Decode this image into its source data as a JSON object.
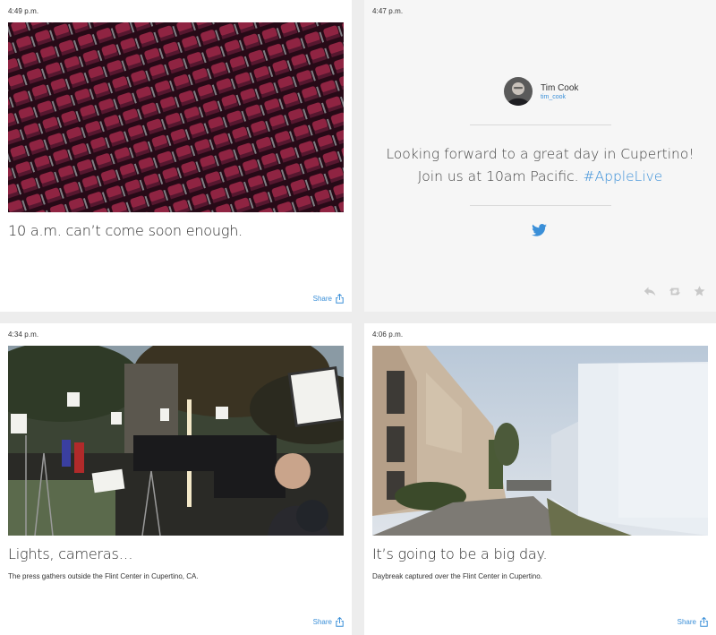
{
  "cards": {
    "seats": {
      "time": "4:49 p.m.",
      "caption": "10 a.m. can’t come soon enough.",
      "share_label": "Share"
    },
    "tweet": {
      "time": "4:47 p.m.",
      "author": "Tim Cook",
      "handle": "tim_cook",
      "text_line1": "Looking forward to a great day in Cupertino!",
      "text_line2": "Join us at 10am Pacific.",
      "hashtag": "#AppleLive",
      "icons": [
        "twitter-bird-icon",
        "reply-icon",
        "retweet-icon",
        "favorite-star-icon"
      ]
    },
    "press": {
      "time": "4:34 p.m.",
      "caption": "Lights, cameras…",
      "subcaption": "The press gathers outside the Flint Center in Cupertino, CA.",
      "share_label": "Share"
    },
    "daybreak": {
      "time": "4:06 p.m.",
      "caption": "It’s going to be a big day.",
      "subcaption": "Daybreak captured over the Flint Center in Cupertino.",
      "share_label": "Share"
    }
  },
  "colors": {
    "accent": "#3a8fd8",
    "background": "#ededed",
    "card": "#ffffff",
    "tweet_card": "#f6f6f6"
  }
}
